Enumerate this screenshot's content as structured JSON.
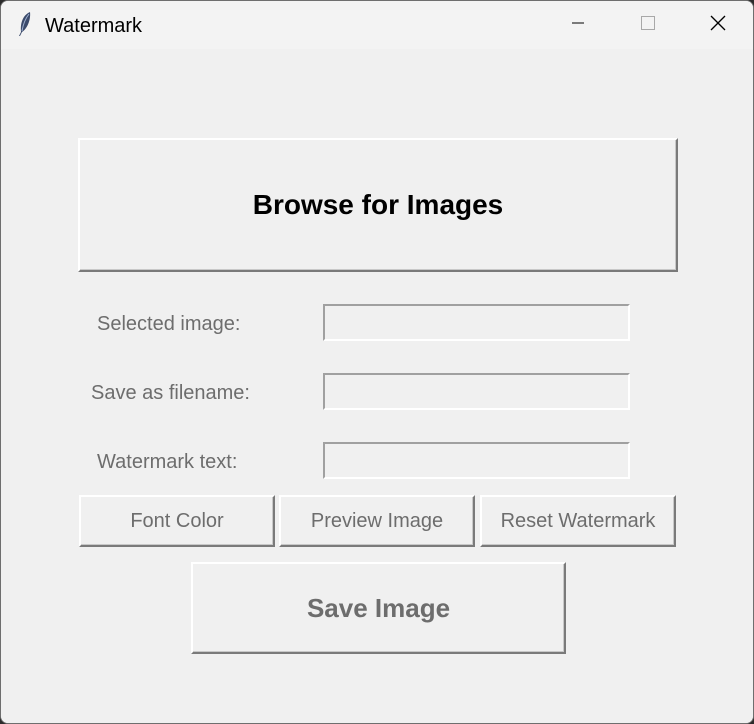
{
  "window": {
    "title": "Watermark",
    "icon": "feather-icon"
  },
  "titlebar": {
    "minimize_icon": "minimize-icon",
    "maximize_icon": "maximize-icon",
    "close_icon": "close-icon"
  },
  "main": {
    "browse_label": "Browse for Images",
    "fields": {
      "selected_image": {
        "label": "Selected image:",
        "value": ""
      },
      "save_filename": {
        "label": "Save as filename:",
        "value": ""
      },
      "watermark_text": {
        "label": "Watermark text:",
        "value": ""
      }
    },
    "buttons": {
      "font_color": "Font Color",
      "preview_image": "Preview Image",
      "reset_watermark": "Reset Watermark",
      "save_image": "Save Image"
    }
  },
  "colors": {
    "background": "#f0f0f0",
    "disabled_text": "#6d6d6d",
    "enabled_text": "#000000"
  }
}
